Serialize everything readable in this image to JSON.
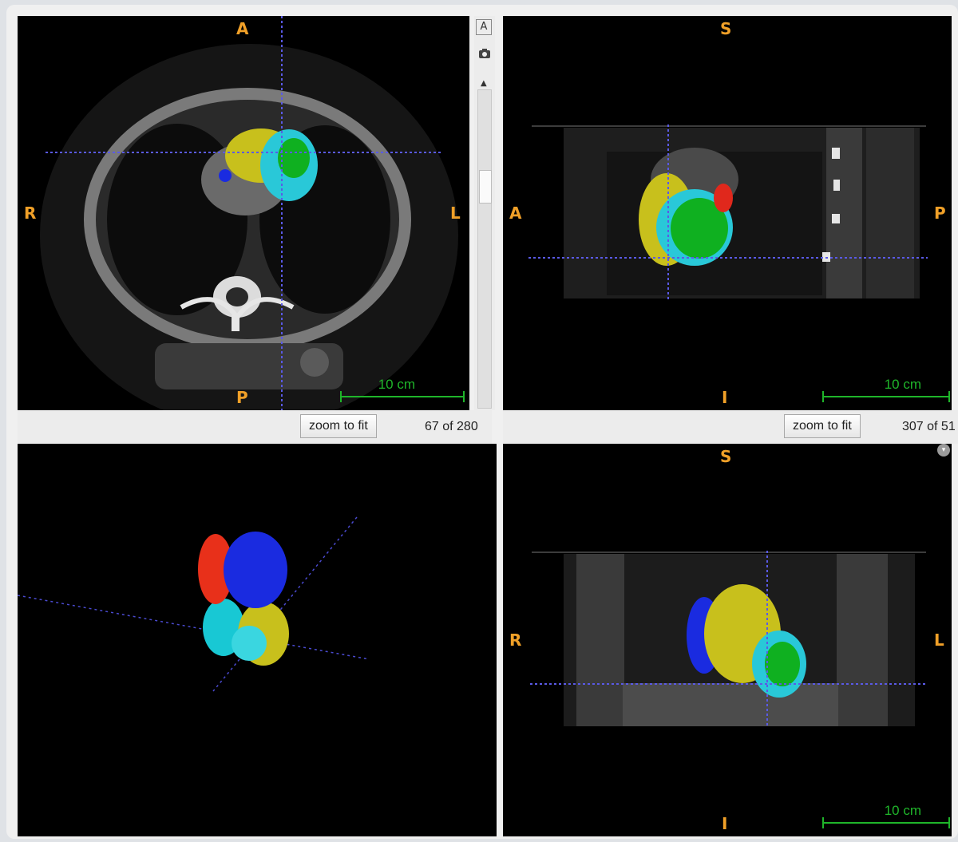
{
  "axial": {
    "top": "A",
    "bottom": "P",
    "left": "R",
    "right": "L",
    "scale": "10 cm",
    "zoom_label": "zoom to fit",
    "slice": "67 of 280"
  },
  "sagittal": {
    "top": "S",
    "bottom": "I",
    "left": "A",
    "right": "P",
    "scale": "10 cm",
    "zoom_label": "zoom to fit",
    "slice": "307 of 51"
  },
  "coronal": {
    "top": "S",
    "bottom": "I",
    "left": "R",
    "right": "L",
    "scale": "10 cm"
  },
  "toolbar": {
    "annotate_icon": "text-annotation-icon",
    "camera_icon": "camera-icon",
    "annotate_glyph": "A"
  },
  "colors": {
    "crosshair": "#5a5ae6",
    "orientation_label": "#f0a028",
    "scale_bar": "#1fb52a",
    "segment_left_ventricle": "#0fb020",
    "segment_myocardium": "#29c8d8",
    "segment_right_ventricle": "#c8c01c",
    "segment_right_atrium": "#1a2be0",
    "segment_left_atrium": "#e0281c"
  }
}
